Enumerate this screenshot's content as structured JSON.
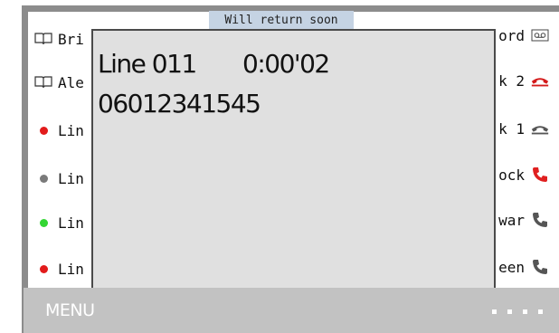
{
  "status_banner": "Will return soon",
  "left_list": [
    {
      "icon": "book-icon",
      "label": "Bri"
    },
    {
      "icon": "book-icon",
      "label": "Ale"
    },
    {
      "icon": "dot",
      "color": "#e21b1b",
      "label": "Lin"
    },
    {
      "icon": "dot",
      "color": "#7a7a7a",
      "label": "Lin"
    },
    {
      "icon": "dot",
      "color": "#33d633",
      "label": "Lin"
    },
    {
      "icon": "dot",
      "color": "#e21b1b",
      "label": "Lin"
    }
  ],
  "right_list": [
    {
      "label": "ord",
      "icon": "voicemail-icon"
    },
    {
      "label": "k 2",
      "icon": "phone-hangup-icon",
      "color": "#d41a1a"
    },
    {
      "label": "k 1",
      "icon": "phone-hangup-icon",
      "color": "#555555"
    },
    {
      "label": "ock",
      "icon": "phone-icon",
      "color": "#e02020"
    },
    {
      "label": "war",
      "icon": "phone-icon",
      "color": "#555555"
    },
    {
      "label": "een",
      "icon": "phone-icon",
      "color": "#555555"
    }
  ],
  "popup": {
    "line_label": "Line 011",
    "duration": "0:00'02",
    "number": "06012341545"
  },
  "menu": {
    "label": "MENU"
  }
}
